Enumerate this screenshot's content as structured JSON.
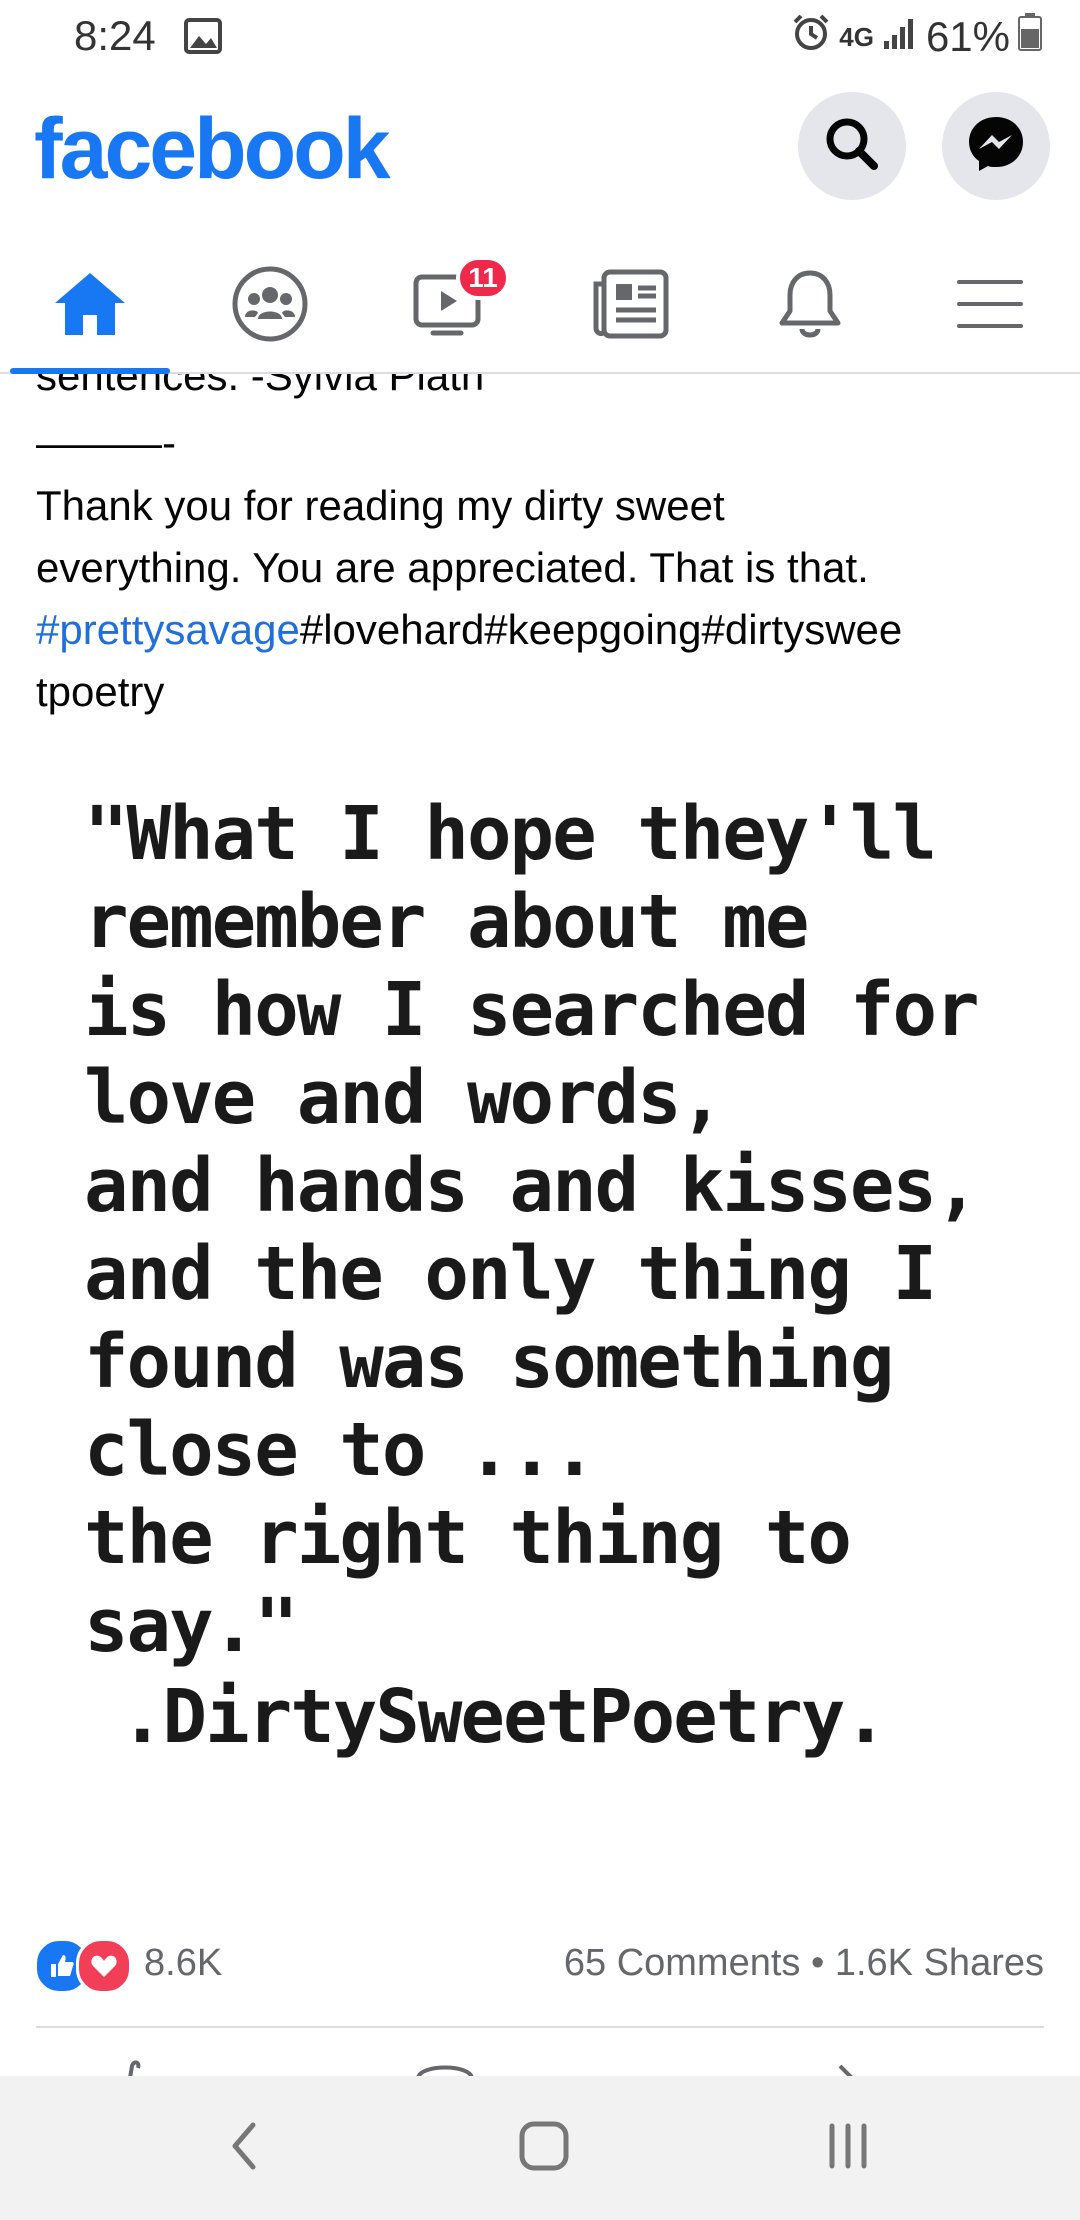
{
  "status_bar": {
    "time": "8:24",
    "network": "4G",
    "battery": "61%",
    "icons": [
      "gallery-icon",
      "alarm-icon",
      "network-icon",
      "signal-icon",
      "battery-icon"
    ]
  },
  "header": {
    "brand": "facebook",
    "brand_color": "#1877f2",
    "search_icon": "search-icon",
    "messenger_icon": "messenger-icon"
  },
  "tabs": {
    "active": "home",
    "items": [
      {
        "name": "home",
        "icon": "home-icon"
      },
      {
        "name": "groups",
        "icon": "groups-icon"
      },
      {
        "name": "watch",
        "icon": "watch-icon",
        "badge": "11"
      },
      {
        "name": "news",
        "icon": "news-icon"
      },
      {
        "name": "notifications",
        "icon": "bell-icon"
      },
      {
        "name": "menu",
        "icon": "menu-icon"
      }
    ]
  },
  "post": {
    "clipped_line": "sentences. -Sylvia Plath",
    "separator": "———-",
    "body_line1": "Thank you for reading my dirty sweet",
    "body_line2": "everything.  You are appreciated.  That is that.",
    "hashtag_link": "#prettysavage",
    "hashtags_rest_line1": "#lovehard#keepgoing#dirtyswee",
    "hashtags_rest_line2": "tpoetry",
    "quote_text": "\"What I hope they'll\nremember about me\nis how I searched for\nlove and words,\nand hands and kisses,\nand the only thing I\nfound was something\nclose to ...\nthe right thing to\nsay.\"",
    "quote_signature": ".DirtySweetPoetry."
  },
  "reactions": {
    "count": "8.6K",
    "comments": "65 Comments",
    "dot": "•",
    "shares": "1.6K Shares",
    "like_color": "#1877f2",
    "love_color": "#f33e58"
  },
  "nav": {
    "back_icon": "back-icon",
    "home_icon": "home-nav-icon",
    "recents_icon": "recents-icon"
  }
}
